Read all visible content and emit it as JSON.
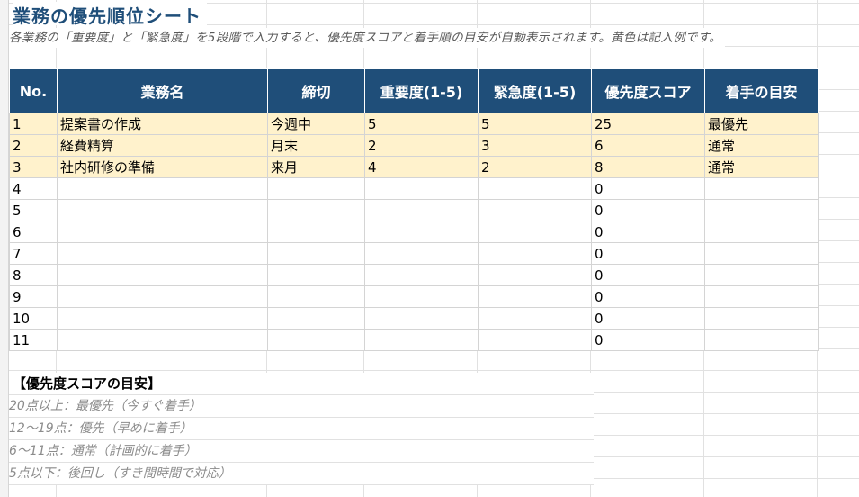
{
  "sheet": {
    "title": "業務の優先順位シート",
    "subtitle": "各業務の「重要度」と「緊急度」を5段階で入力すると、優先度スコアと着手順の目安が自動表示されます。黄色は記入例です。"
  },
  "table": {
    "headers": [
      "No.",
      "業務名",
      "締切",
      "重要度(1-5)",
      "緊急度(1-5)",
      "優先度スコア",
      "着手の目安"
    ],
    "rows": [
      {
        "no": "1",
        "task": "提案書の作成",
        "deadline": "今週中",
        "importance": "5",
        "urgency": "5",
        "score": "25",
        "guide": "最優先",
        "example": true
      },
      {
        "no": "2",
        "task": "経費精算",
        "deadline": "月末",
        "importance": "2",
        "urgency": "3",
        "score": "6",
        "guide": "通常",
        "example": true
      },
      {
        "no": "3",
        "task": "社内研修の準備",
        "deadline": "来月",
        "importance": "4",
        "urgency": "2",
        "score": "8",
        "guide": "通常",
        "example": true
      },
      {
        "no": "4",
        "task": "",
        "deadline": "",
        "importance": "",
        "urgency": "",
        "score": "0",
        "guide": "",
        "example": false
      },
      {
        "no": "5",
        "task": "",
        "deadline": "",
        "importance": "",
        "urgency": "",
        "score": "0",
        "guide": "",
        "example": false
      },
      {
        "no": "6",
        "task": "",
        "deadline": "",
        "importance": "",
        "urgency": "",
        "score": "0",
        "guide": "",
        "example": false
      },
      {
        "no": "7",
        "task": "",
        "deadline": "",
        "importance": "",
        "urgency": "",
        "score": "0",
        "guide": "",
        "example": false
      },
      {
        "no": "8",
        "task": "",
        "deadline": "",
        "importance": "",
        "urgency": "",
        "score": "0",
        "guide": "",
        "example": false
      },
      {
        "no": "9",
        "task": "",
        "deadline": "",
        "importance": "",
        "urgency": "",
        "score": "0",
        "guide": "",
        "example": false
      },
      {
        "no": "10",
        "task": "",
        "deadline": "",
        "importance": "",
        "urgency": "",
        "score": "0",
        "guide": "",
        "example": false
      },
      {
        "no": "11",
        "task": "",
        "deadline": "",
        "importance": "",
        "urgency": "",
        "score": "0",
        "guide": "",
        "example": false
      }
    ]
  },
  "legend": {
    "title": "【優先度スコアの目安】",
    "items": [
      "20点以上：最優先（今すぐ着手）",
      "12～19点：優先（早めに着手）",
      "6～11点：通常（計画的に着手）",
      "5点以下：後回し（すき間時間で対応）"
    ]
  },
  "colors": {
    "header_bg": "#1f4e79",
    "example_row_bg": "#fff2cc",
    "title_color": "#1f4e79"
  }
}
